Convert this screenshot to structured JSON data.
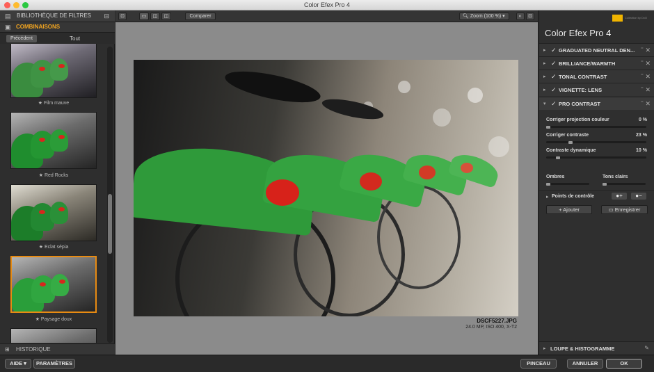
{
  "window": {
    "title": "Color Efex Pro 4"
  },
  "left_panel": {
    "header": "BIBLIOTHÈQUE DE FILTRES",
    "section": "COMBINAISONS",
    "prev_button": "Précédent",
    "filter_all": "Tout",
    "presets": [
      {
        "label": "★ Film mauve"
      },
      {
        "label": "★ Red Rocks"
      },
      {
        "label": "★ Eclat sépia"
      },
      {
        "label": "★ Paysage doux"
      }
    ],
    "history": "HISTORIQUE"
  },
  "toolbar": {
    "compare": "Comparer",
    "zoom": "Zoom (100 %)"
  },
  "image": {
    "filename": "DSCF5227.JPG",
    "meta": "24.0 MP, ISO 400, X-T2"
  },
  "right_panel": {
    "brand": "Color Efex Pro",
    "version": "4",
    "filters": [
      {
        "name": "GRADUATED NEUTRAL DEN..."
      },
      {
        "name": "BRILLIANCE/WARMTH"
      },
      {
        "name": "TONAL CONTRAST"
      },
      {
        "name": "VIGNETTE: LENS"
      },
      {
        "name": "PRO CONTRAST"
      }
    ],
    "sliders": [
      {
        "label": "Corriger projection couleur",
        "value": "0 %",
        "level": 0.0
      },
      {
        "label": "Corriger contraste",
        "value": "23 %",
        "level": 0.23
      },
      {
        "label": "Contraste dynamique",
        "value": "10 %",
        "level": 0.1
      }
    ],
    "shadows": "Ombres",
    "highlights": "Tons clairs",
    "control_points": "Points de contrôle",
    "add_button": "Ajouter",
    "save_button": "Enregistrer",
    "loupe": "LOUPE & HISTOGRAMME"
  },
  "bottom": {
    "help": "AIDE",
    "settings": "PARAMÈTRES",
    "brush": "PINCEAU",
    "cancel": "ANNULER",
    "ok": "OK"
  }
}
